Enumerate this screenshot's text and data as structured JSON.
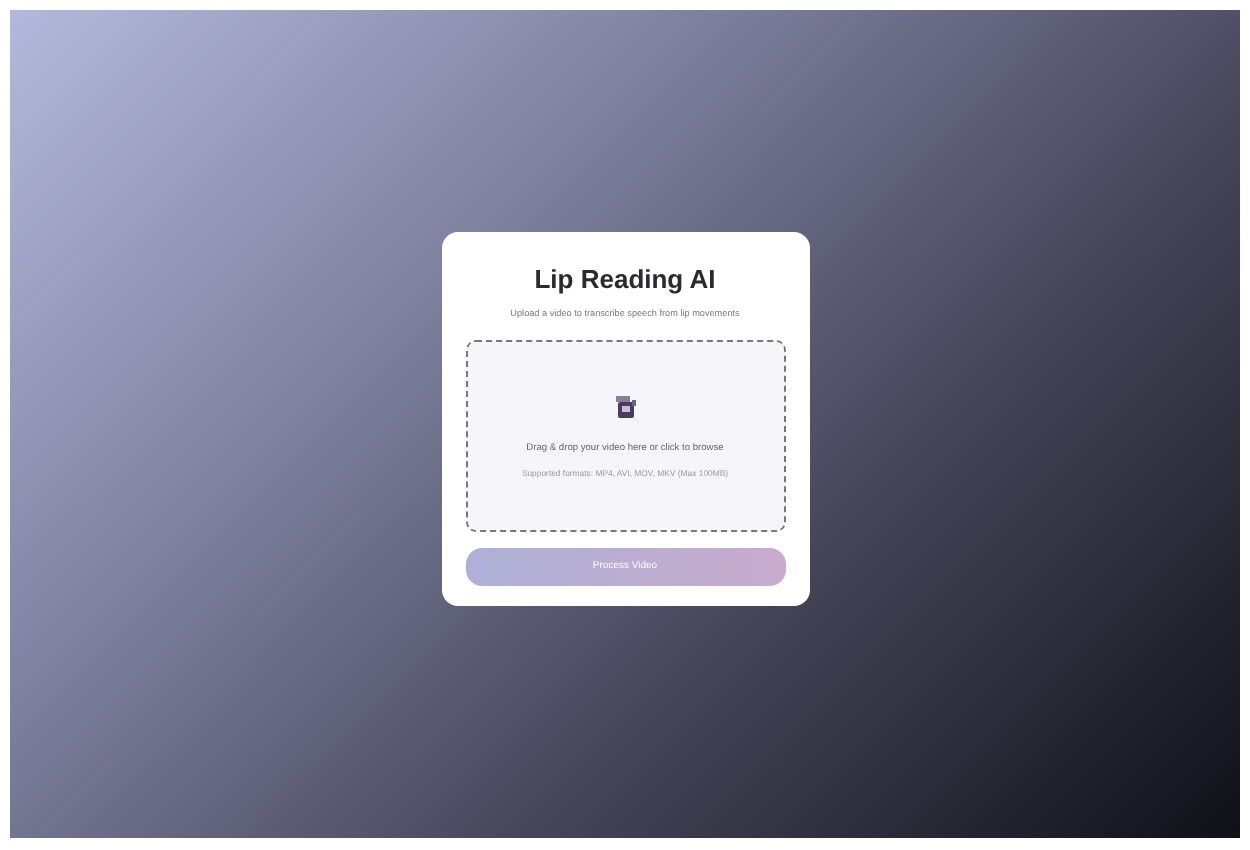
{
  "card": {
    "title": "Lip Reading AI",
    "subtitle": "Upload a video to transcribe speech from lip movements"
  },
  "dropzone": {
    "prompt": "Drag & drop your video here or click to browse",
    "formats": "Supported formats: MP4, AVI, MOV, MKV (Max 100MB)"
  },
  "button": {
    "label": "Process Video",
    "disabled": true
  }
}
